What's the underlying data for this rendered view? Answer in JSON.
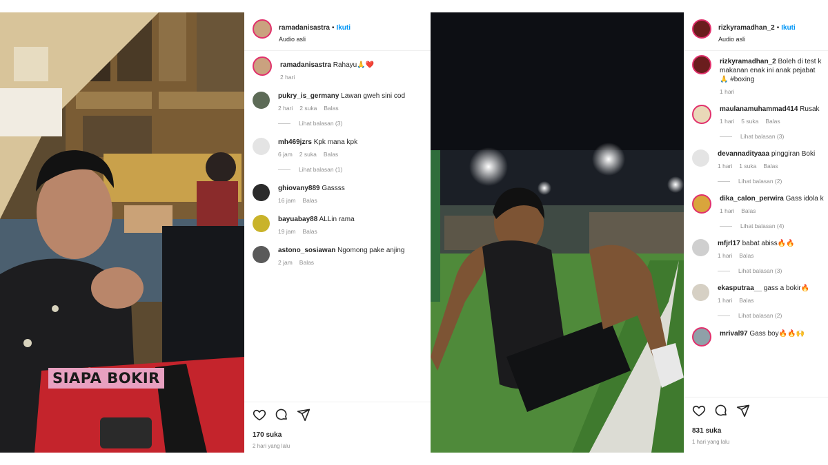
{
  "post1": {
    "header": {
      "username": "ramadanisastra",
      "follow_label": "Ikuti",
      "audio_label": "Audio asli"
    },
    "caption": {
      "username": "ramadanisastra",
      "text": "Rahayu🙏❤️",
      "time": "2 hari"
    },
    "video_caption": "SIAPA BOKIR",
    "comments": [
      {
        "username": "pukry_is_germany",
        "text": "Lawan gweh sini cod",
        "time": "2 hari",
        "likes": "2 suka",
        "reply": "Balas",
        "view_replies": "Lihat balasan (3)"
      },
      {
        "username": "mh469jzrs",
        "text": "Kpk mana kpk",
        "time": "6 jam",
        "likes": "2 suka",
        "reply": "Balas",
        "view_replies": "Lihat balasan (1)"
      },
      {
        "username": "ghiovany889",
        "text": "Gassss",
        "time": "16 jam",
        "likes": "",
        "reply": "Balas",
        "view_replies": ""
      },
      {
        "username": "bayuabay88",
        "text": "ALLin rama",
        "time": "19 jam",
        "likes": "",
        "reply": "Balas",
        "view_replies": ""
      },
      {
        "username": "astono_sosiawan",
        "text": "Ngomong pake anjing",
        "time": "2 jam",
        "likes": "",
        "reply": "Balas",
        "view_replies": ""
      }
    ],
    "like_count": "170 suka",
    "posted": "2 hari yang lalu"
  },
  "post2": {
    "header": {
      "username": "rizkyramadhan_2",
      "follow_label": "Ikuti",
      "audio_label": "Audio asli"
    },
    "caption": {
      "username": "rizkyramadhan_2",
      "text": "Boleh di test k makanan enak ini anak pejabat 🙏 #boxing",
      "time": "1 hari"
    },
    "comments": [
      {
        "username": "maulanamuhammad414",
        "text": "Rusak",
        "time": "1 hari",
        "likes": "5 suka",
        "reply": "Balas",
        "view_replies": "Lihat balasan (3)"
      },
      {
        "username": "devannadityaaa",
        "text": "pinggiran Boki",
        "time": "1 hari",
        "likes": "1 suka",
        "reply": "Balas",
        "view_replies": "Lihat balasan (2)"
      },
      {
        "username": "dika_calon_perwira",
        "text": "Gass idola k",
        "time": "1 hari",
        "likes": "",
        "reply": "Balas",
        "view_replies": "Lihat balasan (4)"
      },
      {
        "username": "mfjrl17",
        "text": "babat abiss🔥🔥",
        "time": "1 hari",
        "likes": "",
        "reply": "Balas",
        "view_replies": "Lihat balasan (3)"
      },
      {
        "username": "ekasputraa__",
        "text": "gass a bokir🔥",
        "time": "1 hari",
        "likes": "",
        "reply": "Balas",
        "view_replies": "Lihat balasan (2)"
      },
      {
        "username": "mrival97",
        "text": "Gass boy🔥🔥🙌",
        "time": "",
        "likes": "",
        "reply": "",
        "view_replies": ""
      }
    ],
    "like_count": "831 suka",
    "posted": "1 hari yang lalu"
  },
  "colors": {
    "accent": "#0095f6",
    "story_ring": "#e1306c",
    "muted": "#8e8e8e",
    "caption_bg": "#e8a0c0"
  },
  "icons": [
    "heart-icon",
    "comment-icon",
    "share-icon",
    "heart-outline-icon"
  ]
}
